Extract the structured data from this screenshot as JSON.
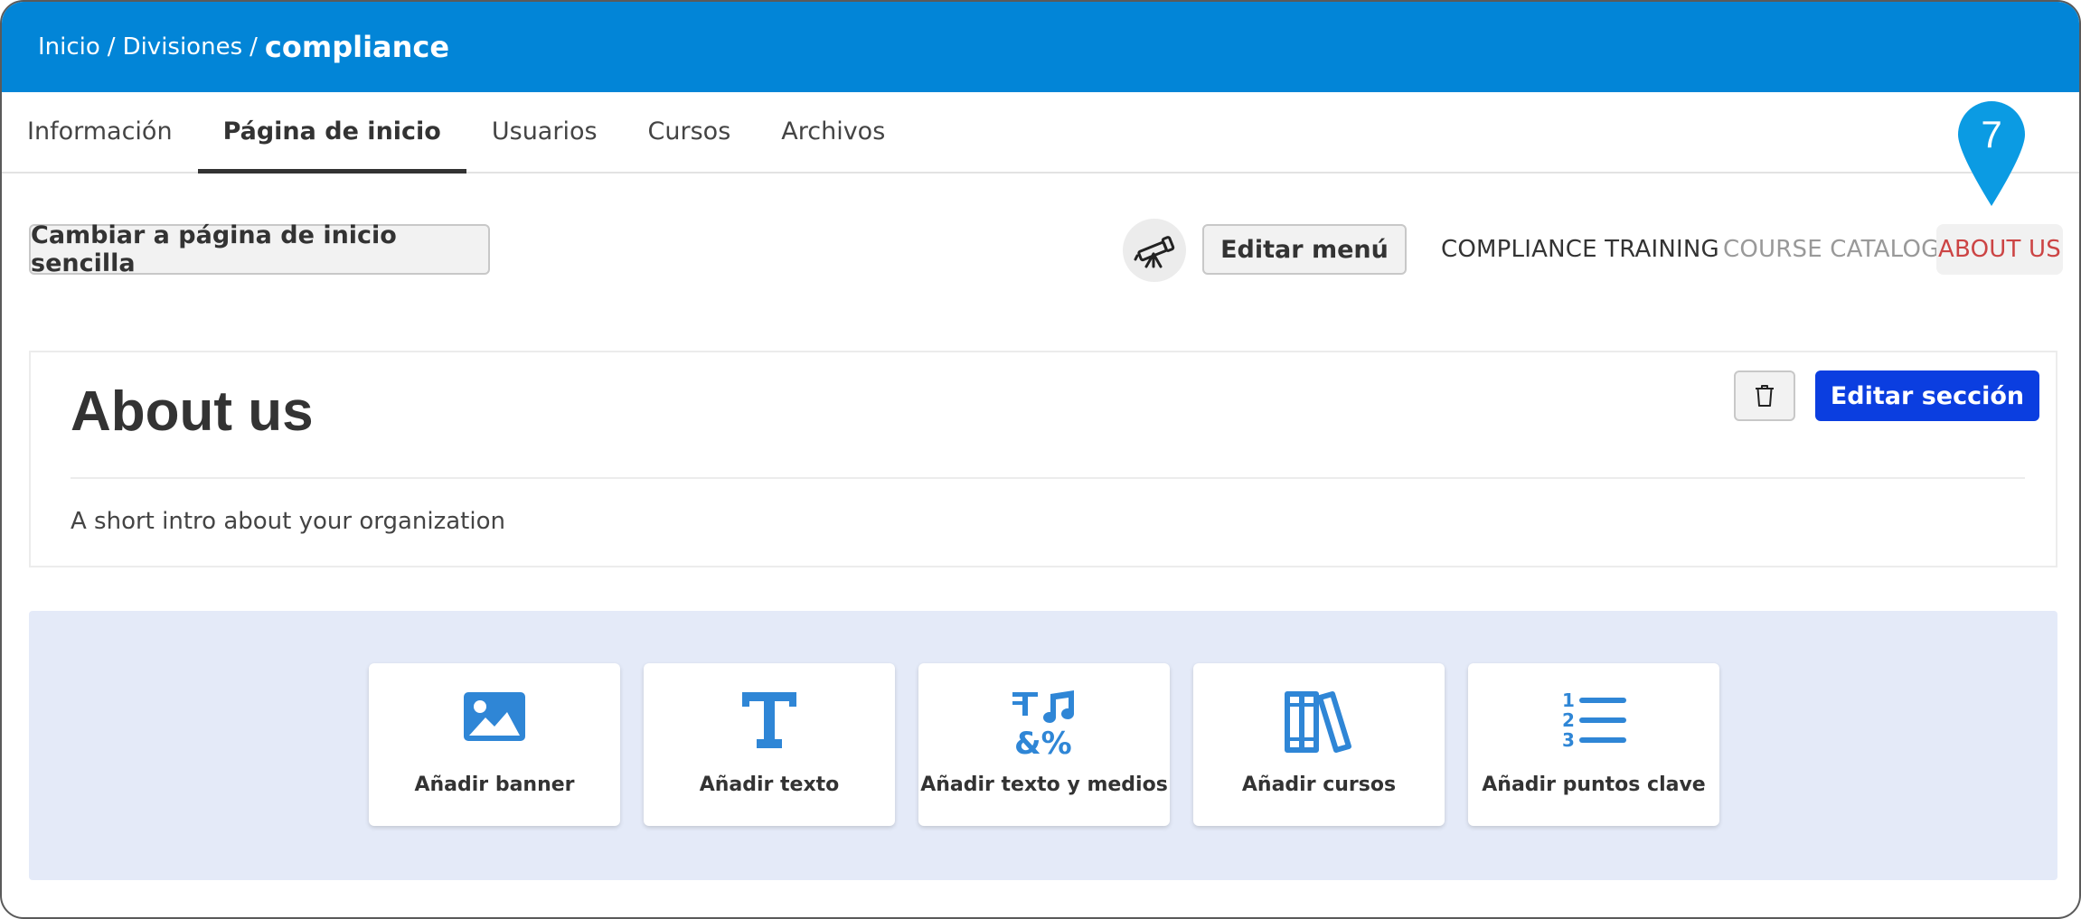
{
  "breadcrumb": {
    "home": "Inicio",
    "divisions": "Divisiones",
    "current": "compliance",
    "separator": "/"
  },
  "tabs": [
    {
      "label": "Información",
      "active": false
    },
    {
      "label": "Página de inicio",
      "active": true
    },
    {
      "label": "Usuarios",
      "active": false
    },
    {
      "label": "Cursos",
      "active": false
    },
    {
      "label": "Archivos",
      "active": false
    }
  ],
  "toolbar": {
    "switch_label": "Cambiar a página de inicio sencilla",
    "edit_menu_label": "Editar menú",
    "menu_links": [
      "COMPLIANCE TRAINING",
      "COURSE CATALOG",
      "ABOUT US"
    ]
  },
  "pin": {
    "number": "7",
    "color": "#0b9be3"
  },
  "section": {
    "title": "About us",
    "body": "A short intro about your organization",
    "edit_label": "Editar sección"
  },
  "add_blocks": [
    {
      "label": "Añadir banner",
      "icon": "image-icon"
    },
    {
      "label": "Añadir texto",
      "icon": "text-icon"
    },
    {
      "label": "Añadir texto y medios",
      "icon": "text-media-icon"
    },
    {
      "label": "Añadir cursos",
      "icon": "books-icon"
    },
    {
      "label": "Añadir puntos clave",
      "icon": "numbered-list-icon"
    }
  ],
  "colors": {
    "header": "#0285d7",
    "primary_button": "#0b3ee0",
    "icon_blue": "#2f86d6",
    "panel_bg": "#e4eaf8",
    "active_link": "#cc4444"
  }
}
